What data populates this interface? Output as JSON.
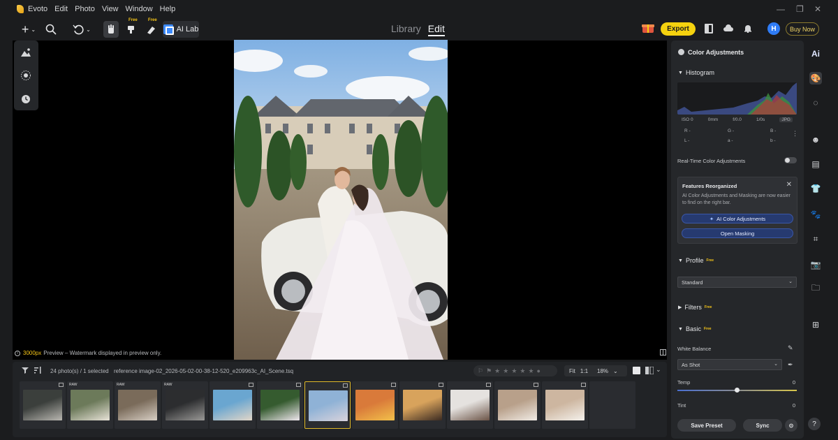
{
  "app": {
    "name": "Evoto"
  },
  "menu": [
    "Edit",
    "Photo",
    "View",
    "Window",
    "Help"
  ],
  "toolbar": {
    "free_badge": "Free",
    "ai_lab_label": "AI Lab",
    "export_label": "Export",
    "avatar_initial": "H",
    "buy_now_label": "Buy Now"
  },
  "mode_tabs": [
    {
      "label": "Library",
      "active": false
    },
    {
      "label": "Edit",
      "active": true
    }
  ],
  "canvas": {
    "preview_highlight": "3000px",
    "preview_text": "Preview – Watermark displayed in preview only."
  },
  "filmstrip": {
    "count_text": "24 photo(s) / 1 selected",
    "file_name": "reference image-02_2026-05-02-00-38-12-520_e209963c_AI_Scene.tsq",
    "zoom_fit": "Fit",
    "zoom_1to1": "1:1",
    "zoom_percent": "18%",
    "raw_label": "RAW",
    "thumbs": [
      {
        "raw": false,
        "selected": false,
        "c1": "#3b3f3c",
        "c2": "#b9b7b1"
      },
      {
        "raw": true,
        "selected": false,
        "c1": "#6c7a5a",
        "c2": "#e8e3d8"
      },
      {
        "raw": true,
        "selected": false,
        "c1": "#7a6b5a",
        "c2": "#d8cfc5"
      },
      {
        "raw": true,
        "selected": false,
        "c1": "#2c2d2f",
        "c2": "#9a9997"
      },
      {
        "raw": false,
        "selected": false,
        "c1": "#6aa6d0",
        "c2": "#e2d6c8"
      },
      {
        "raw": false,
        "selected": false,
        "c1": "#355b2f",
        "c2": "#efe7ee"
      },
      {
        "raw": false,
        "selected": true,
        "c1": "#8fb2d6",
        "c2": "#d9d3dc"
      },
      {
        "raw": false,
        "selected": false,
        "c1": "#d97a3a",
        "c2": "#f2c04a"
      },
      {
        "raw": false,
        "selected": false,
        "c1": "#d8a35c",
        "c2": "#3b2b22"
      },
      {
        "raw": false,
        "selected": false,
        "c1": "#e5e2df",
        "c2": "#6b5346"
      },
      {
        "raw": false,
        "selected": false,
        "c1": "#b8a08a",
        "c2": "#f1ece6"
      },
      {
        "raw": false,
        "selected": false,
        "c1": "#cdb6a0",
        "c2": "#f4f1ec"
      }
    ]
  },
  "panel": {
    "title": "Color Adjustments",
    "histogram_label": "Histogram",
    "meta": {
      "iso": "ISO 0",
      "focal": "0mm",
      "aperture": "f/0.0",
      "shutter": "1/0s",
      "format": "JPG"
    },
    "rgb": {
      "r": "R -",
      "g": "G -",
      "b": "B -",
      "l": "L -",
      "a": "a -",
      "bb": "b -"
    },
    "realtime_label": "Real-Time Color Adjustments",
    "features": {
      "title": "Features Reorganized",
      "desc": "AI Color Adjustments and Masking are now easier to find on the right bar.",
      "btn_ai": "AI Color Adjustments",
      "btn_mask": "Open Masking"
    },
    "profile_label": "Profile",
    "profile_value": "Standard",
    "filters_label": "Filters",
    "basic_label": "Basic",
    "wb_label": "White Balance",
    "wb_value": "As Shot",
    "temp_label": "Temp",
    "temp_value": "0",
    "temp_level": 0.5,
    "tint_label": "Tint",
    "tint_value": "0",
    "free_badge": "Free",
    "save_preset": "Save Preset",
    "sync": "Sync"
  },
  "sidebar": {
    "ai_label": "Ai",
    "help": "?"
  }
}
